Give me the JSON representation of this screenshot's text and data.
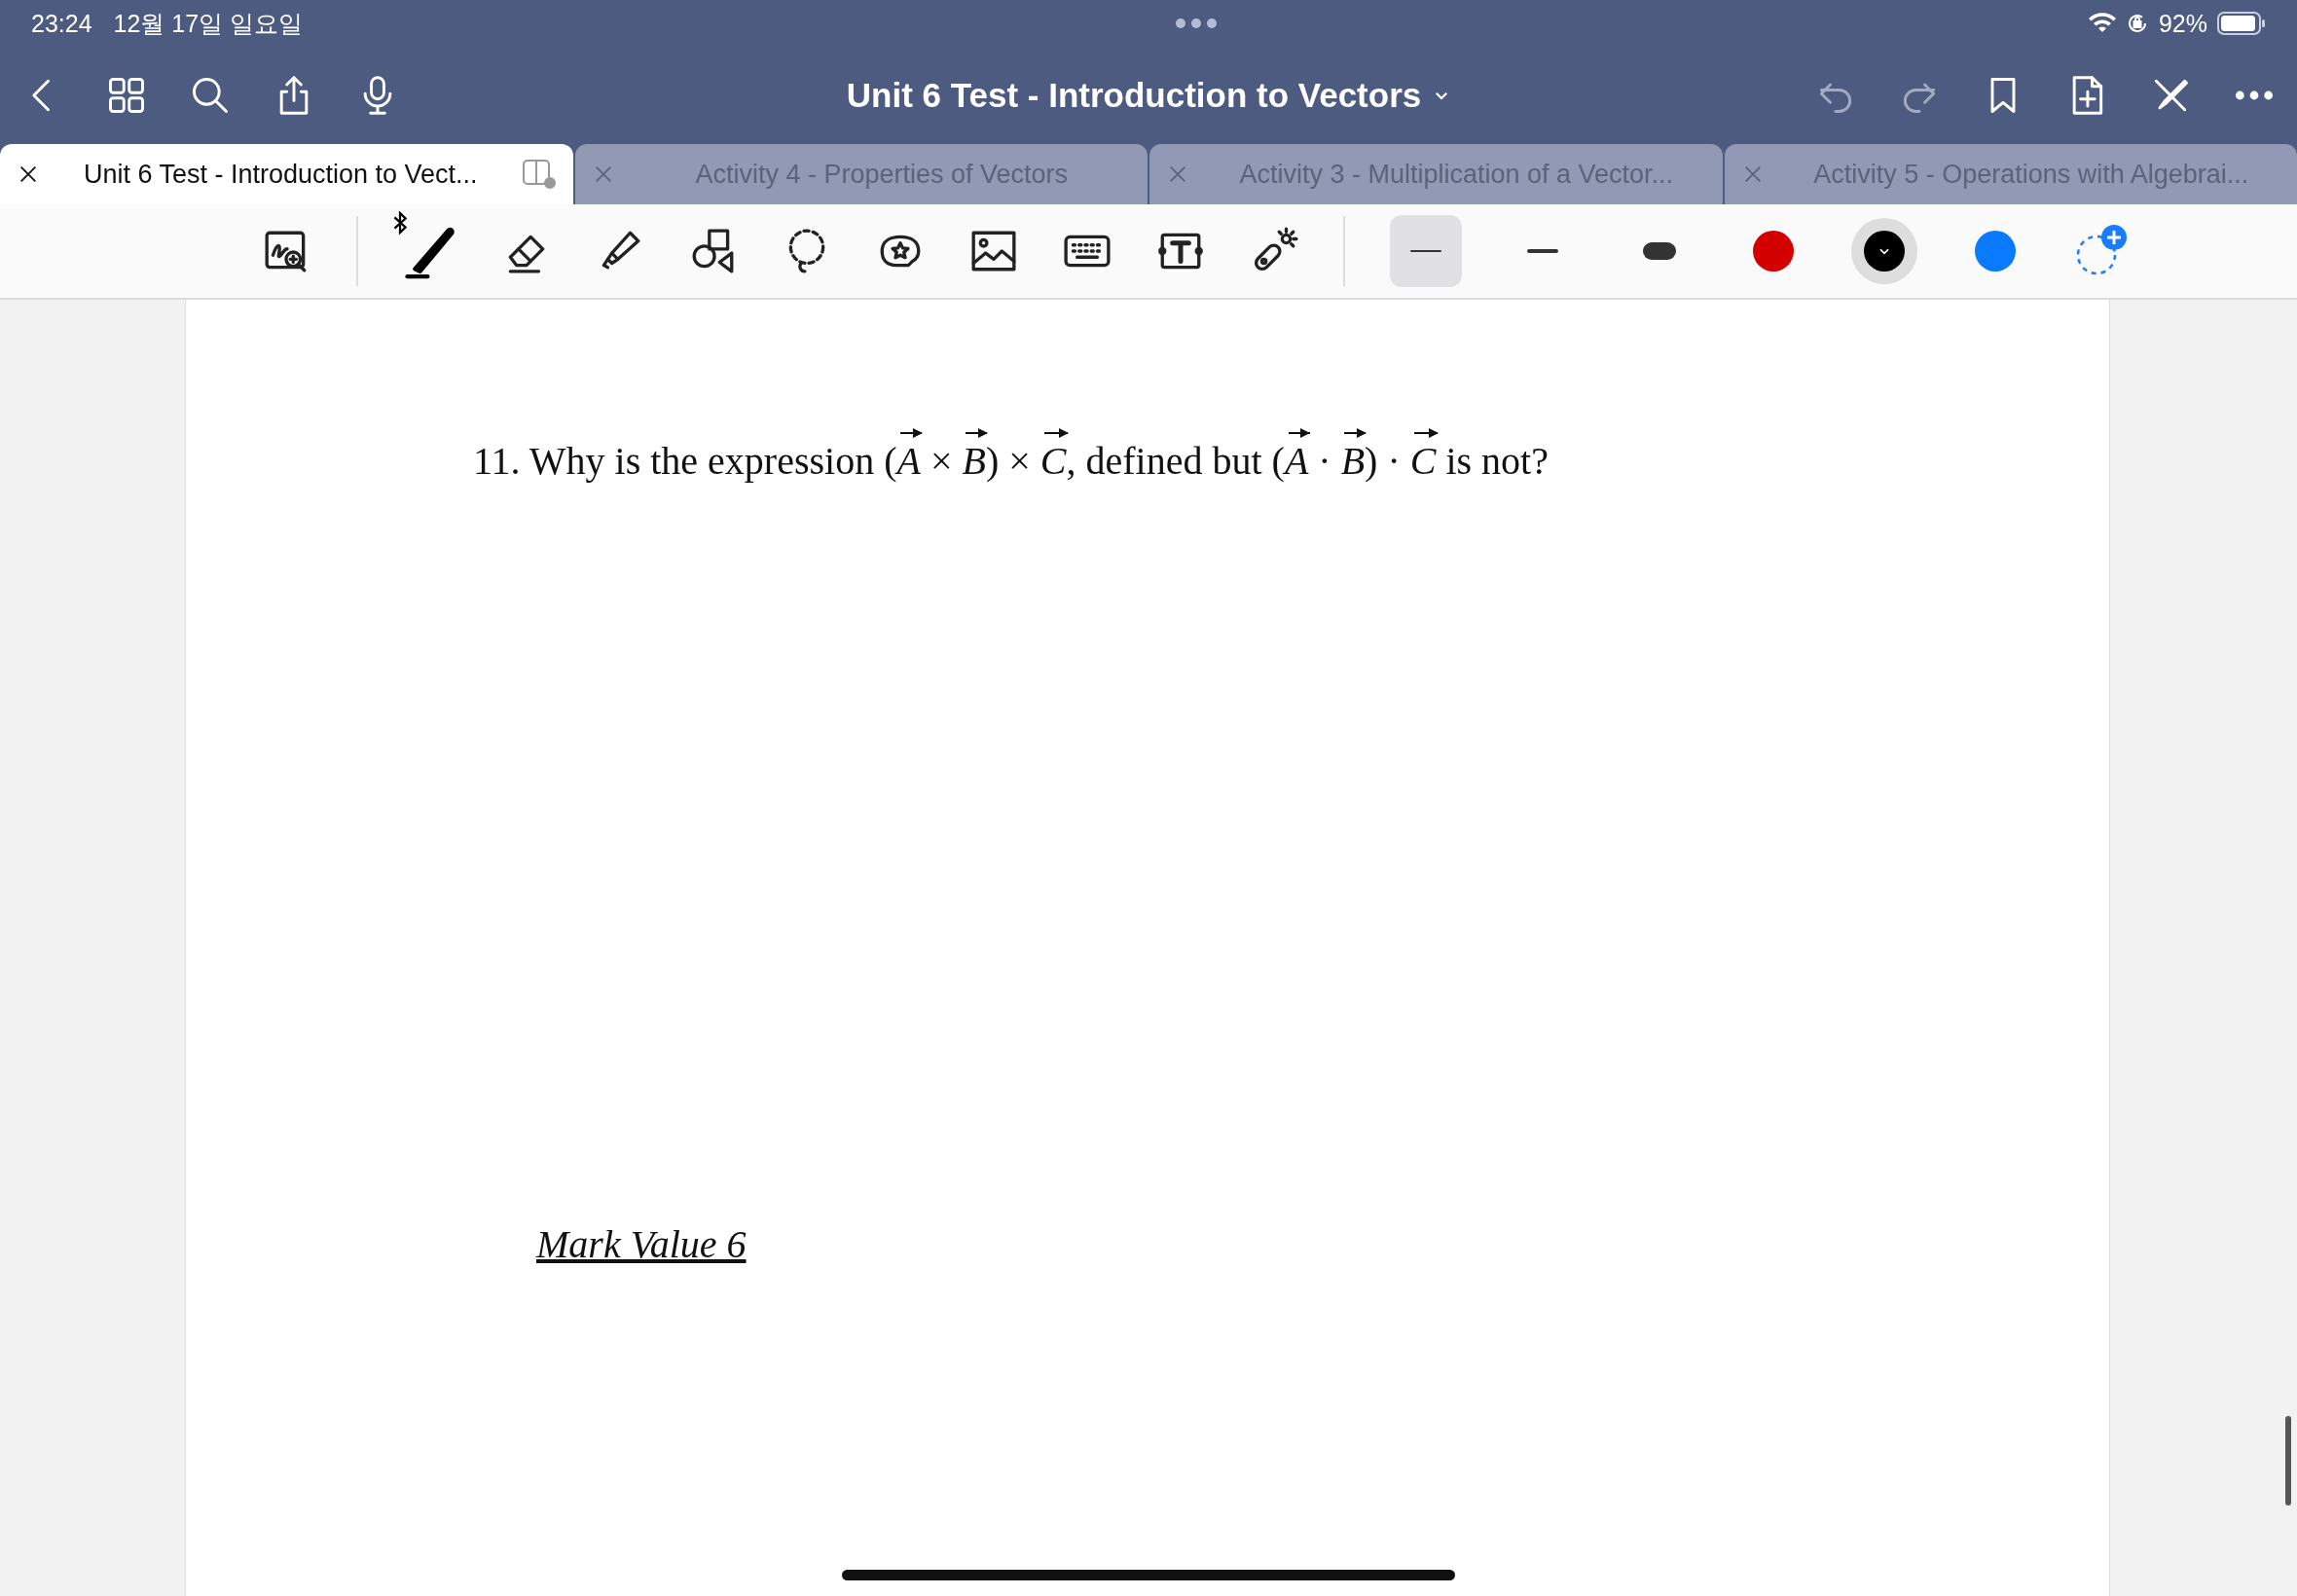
{
  "status_bar": {
    "time": "23:24",
    "date": "12월 17일 일요일",
    "battery": "92%"
  },
  "nav": {
    "title": "Unit 6 Test - Introduction to Vectors",
    "right_buttons": [
      {
        "kind": "undo",
        "disabled": true
      },
      {
        "kind": "redo",
        "disabled": true
      },
      {
        "kind": "bookmark",
        "disabled": false
      },
      {
        "kind": "add-page",
        "disabled": false
      },
      {
        "kind": "close-pen",
        "disabled": false
      },
      {
        "kind": "more",
        "disabled": false
      }
    ]
  },
  "tabs": [
    {
      "label": "Unit 6 Test - Introduction to Vect...",
      "selected": true
    },
    {
      "label": "Activity 4 - Properties of Vectors",
      "selected": false
    },
    {
      "label": "Activity 3 - Multiplication of a Vector...",
      "selected": false
    },
    {
      "label": "Activity 5 - Operations with Algebrai...",
      "selected": false
    }
  ],
  "toolbar": {
    "tools": [
      {
        "kind": "zoom",
        "selected": false
      },
      {
        "kind": "pen",
        "selected": true
      },
      {
        "kind": "eraser",
        "selected": false
      },
      {
        "kind": "highlighter",
        "selected": false
      },
      {
        "kind": "shapes",
        "selected": false
      },
      {
        "kind": "lasso",
        "selected": false
      },
      {
        "kind": "sticker",
        "selected": false
      },
      {
        "kind": "image",
        "selected": false
      },
      {
        "kind": "keyboard",
        "selected": false
      },
      {
        "kind": "text",
        "selected": false
      },
      {
        "kind": "laser",
        "selected": false
      }
    ],
    "widths": [
      {
        "kind": "thin",
        "selected": true
      },
      {
        "kind": "medium",
        "selected": false
      },
      {
        "kind": "thick",
        "selected": false
      }
    ],
    "colors": [
      {
        "color": "#d40000",
        "selected": false
      },
      {
        "color": "#000000",
        "selected": true
      },
      {
        "color": "#0a7aff",
        "selected": false
      }
    ]
  },
  "document": {
    "question": "11. Why is the expression (*A* × *B*) × *C*, defined but (*A* · *B*) · *C* is not?",
    "mark_value": "Mark Value 6"
  }
}
